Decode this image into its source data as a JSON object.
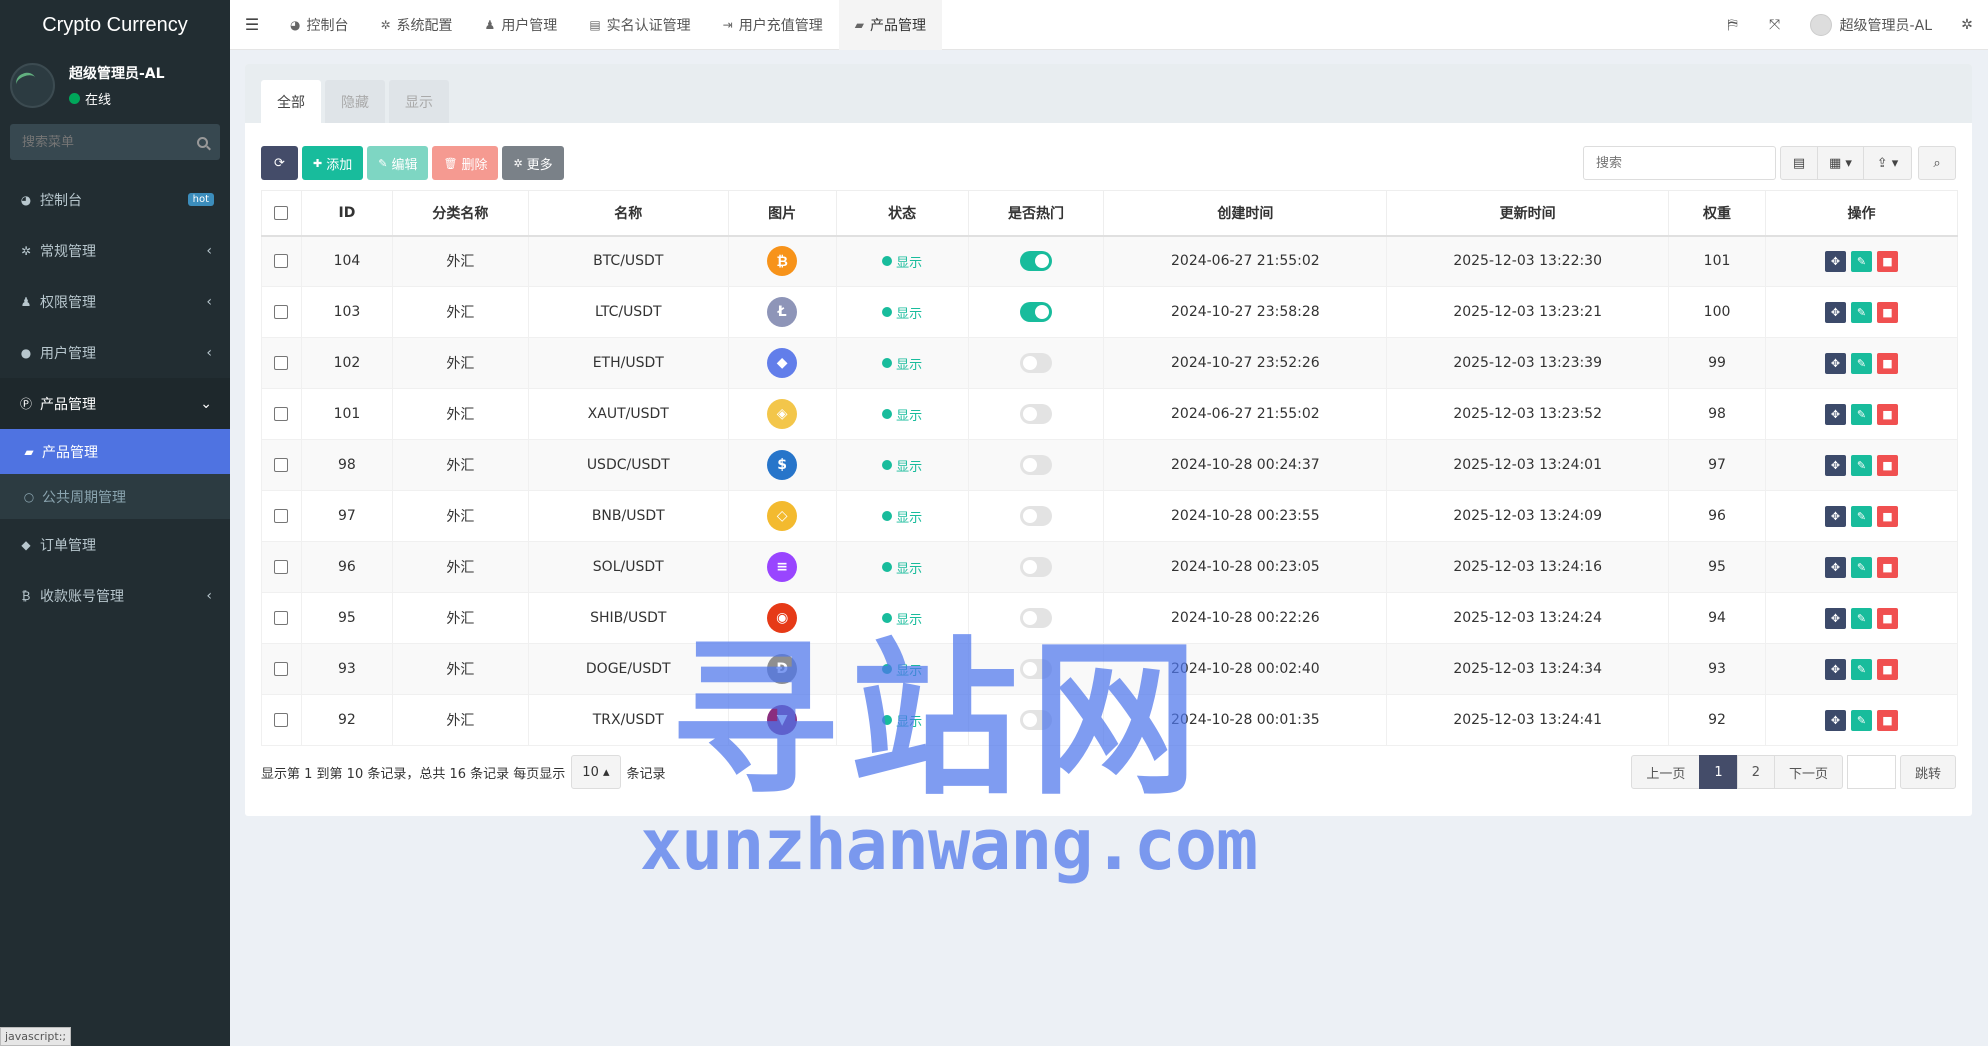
{
  "app": {
    "title": "Crypto Currency"
  },
  "user": {
    "name": "超级管理员-AL",
    "status": "在线"
  },
  "sidebar": {
    "search_placeholder": "搜索菜单",
    "items": [
      {
        "label": "控制台",
        "icon": "dashboard-icon",
        "badge": "hot"
      },
      {
        "label": "常规管理",
        "icon": "cogs-icon"
      },
      {
        "label": "权限管理",
        "icon": "group-icon"
      },
      {
        "label": "用户管理",
        "icon": "user-circle-icon"
      },
      {
        "label": "产品管理",
        "icon": "product-icon"
      },
      {
        "label": "订单管理",
        "icon": "diamond-icon"
      },
      {
        "label": "收款账号管理",
        "icon": "bitcoin-icon"
      }
    ],
    "submenu": [
      {
        "label": "产品管理",
        "icon": "shopping-bag-icon"
      },
      {
        "label": "公共周期管理",
        "icon": "circle-icon"
      }
    ]
  },
  "navbar": {
    "tabs": [
      {
        "label": "控制台",
        "icon": "dashboard-icon"
      },
      {
        "label": "系统配置",
        "icon": "gear-icon"
      },
      {
        "label": "用户管理",
        "icon": "user-icon"
      },
      {
        "label": "实名认证管理",
        "icon": "id-card-icon"
      },
      {
        "label": "用户充值管理",
        "icon": "sign-in-icon"
      },
      {
        "label": "产品管理",
        "icon": "shopping-bag-icon"
      }
    ],
    "user_label": "超级管理员-AL"
  },
  "panel": {
    "tabs": [
      "全部",
      "隐藏",
      "显示"
    ],
    "toolbar": {
      "add": "添加",
      "edit": "编辑",
      "delete": "删除",
      "more": "更多"
    },
    "search_placeholder": "搜索",
    "columns": [
      "ID",
      "分类名称",
      "名称",
      "图片",
      "状态",
      "是否热门",
      "创建时间",
      "更新时间",
      "权重",
      "操作"
    ],
    "rows": [
      {
        "id": "104",
        "category": "外汇",
        "name": "BTC/USDT",
        "coin": "btc",
        "status": "显示",
        "hot": true,
        "created": "2024-06-27 21:55:02",
        "updated": "2025-12-03 13:22:30",
        "weight": "101"
      },
      {
        "id": "103",
        "category": "外汇",
        "name": "LTC/USDT",
        "coin": "ltc",
        "status": "显示",
        "hot": true,
        "created": "2024-10-27 23:58:28",
        "updated": "2025-12-03 13:23:21",
        "weight": "100"
      },
      {
        "id": "102",
        "category": "外汇",
        "name": "ETH/USDT",
        "coin": "eth",
        "status": "显示",
        "hot": false,
        "created": "2024-10-27 23:52:26",
        "updated": "2025-12-03 13:23:39",
        "weight": "99"
      },
      {
        "id": "101",
        "category": "外汇",
        "name": "XAUT/USDT",
        "coin": "xaut",
        "status": "显示",
        "hot": false,
        "created": "2024-06-27 21:55:02",
        "updated": "2025-12-03 13:23:52",
        "weight": "98"
      },
      {
        "id": "98",
        "category": "外汇",
        "name": "USDC/USDT",
        "coin": "usdc",
        "status": "显示",
        "hot": false,
        "created": "2024-10-28 00:24:37",
        "updated": "2025-12-03 13:24:01",
        "weight": "97"
      },
      {
        "id": "97",
        "category": "外汇",
        "name": "BNB/USDT",
        "coin": "bnb",
        "status": "显示",
        "hot": false,
        "created": "2024-10-28 00:23:55",
        "updated": "2025-12-03 13:24:09",
        "weight": "96"
      },
      {
        "id": "96",
        "category": "外汇",
        "name": "SOL/USDT",
        "coin": "sol",
        "status": "显示",
        "hot": false,
        "created": "2024-10-28 00:23:05",
        "updated": "2025-12-03 13:24:16",
        "weight": "95"
      },
      {
        "id": "95",
        "category": "外汇",
        "name": "SHIB/USDT",
        "coin": "shib",
        "status": "显示",
        "hot": false,
        "created": "2024-10-28 00:22:26",
        "updated": "2025-12-03 13:24:24",
        "weight": "94"
      },
      {
        "id": "93",
        "category": "外汇",
        "name": "DOGE/USDT",
        "coin": "doge",
        "status": "显示",
        "hot": false,
        "created": "2024-10-28 00:02:40",
        "updated": "2025-12-03 13:24:34",
        "weight": "93"
      },
      {
        "id": "92",
        "category": "外汇",
        "name": "TRX/USDT",
        "coin": "trx",
        "status": "显示",
        "hot": false,
        "created": "2024-10-28 00:01:35",
        "updated": "2025-12-03 13:24:41",
        "weight": "92"
      }
    ],
    "footer": {
      "info": "显示第 1 到第 10 条记录，总共 16 条记录 每页显示",
      "page_size": "10",
      "suffix": "条记录"
    },
    "pager": {
      "prev": "上一页",
      "pages": [
        "1",
        "2"
      ],
      "next": "下一页",
      "go": "跳转"
    }
  },
  "coin_colors": {
    "btc": "#f7931a",
    "ltc": "#8e95b8",
    "eth": "#627eea",
    "xaut": "#f3c64a",
    "usdc": "#2775ca",
    "bnb": "#f3ba2f",
    "sol": "#9945ff",
    "shib": "#e63a17",
    "doge": "#8f8f8f",
    "trx": "#8a2d7e"
  },
  "watermark": {
    "cn": "寻站网",
    "en": "xunzhanwang.com"
  },
  "statusbar": "javascript:;"
}
